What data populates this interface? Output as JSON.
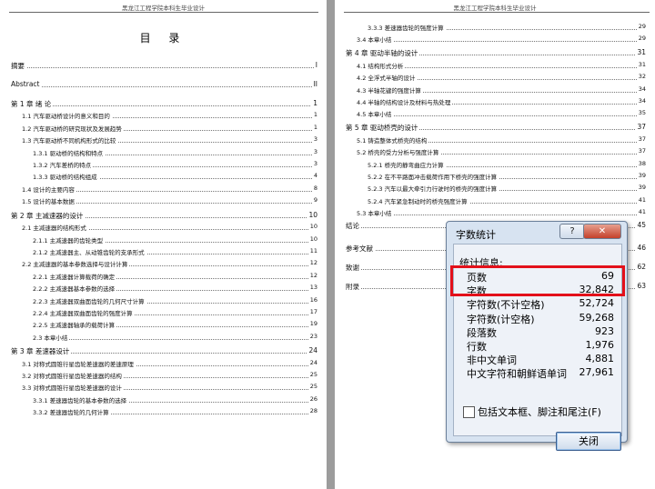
{
  "header_text": "黑龙江工程学院本科生毕业设计",
  "toc_title": "目  录",
  "page1_entries": [
    {
      "text": "摘要",
      "page": "I",
      "lvl": 1
    },
    {
      "text": "Abstract",
      "page": "II",
      "lvl": 1
    },
    {
      "text": "第 1 章  绪 论",
      "page": "1",
      "lvl": 1
    },
    {
      "text": "1.1 汽车驱动桥设计的意义和目的",
      "page": "1",
      "lvl": 2
    },
    {
      "text": "1.2 汽车驱动桥的研究现状及发展趋势",
      "page": "1",
      "lvl": 2
    },
    {
      "text": "1.3 汽车驱动桥不同机构形式的比较",
      "page": "3",
      "lvl": 2
    },
    {
      "text": "1.3.1 驱动桥的结构和特点",
      "page": "3",
      "lvl": 3
    },
    {
      "text": "1.3.2 汽车差桥的特点",
      "page": "3",
      "lvl": 3
    },
    {
      "text": "1.3.3 驱动桥的结构组成",
      "page": "4",
      "lvl": 3
    },
    {
      "text": "1.4 设计的主要内容",
      "page": "8",
      "lvl": 2
    },
    {
      "text": "1.5 设计的基本数据",
      "page": "9",
      "lvl": 2
    },
    {
      "text": "第 2 章  主减速器的设计",
      "page": "10",
      "lvl": 1
    },
    {
      "text": "2.1 主减速器的结构形式",
      "page": "10",
      "lvl": 2
    },
    {
      "text": "2.1.1 主减速器的齿轮类型",
      "page": "10",
      "lvl": 3
    },
    {
      "text": "2.1.2 主减速器主、从动锥齿轮的支承形式",
      "page": "11",
      "lvl": 3
    },
    {
      "text": "2.2 主减速器的基本参数选择与设计计算",
      "page": "12",
      "lvl": 2
    },
    {
      "text": "2.2.1 主减速器计算载荷的确定",
      "page": "12",
      "lvl": 3
    },
    {
      "text": "2.2.2 主减速器基本参数的选择",
      "page": "13",
      "lvl": 3
    },
    {
      "text": "2.2.3 主减速器双曲面齿轮的几何尺寸计算",
      "page": "16",
      "lvl": 3
    },
    {
      "text": "2.2.4 主减速器双曲面齿轮的强度计算",
      "page": "17",
      "lvl": 3
    },
    {
      "text": "2.2.5 主减速器轴承的载荷计算",
      "page": "19",
      "lvl": 3
    },
    {
      "text": "2.3 本章小结",
      "page": "23",
      "lvl": 3
    },
    {
      "text": "第 3 章  差速器设计",
      "page": "24",
      "lvl": 1
    },
    {
      "text": "3.1 对称式圆锥行星齿轮差速器的差速原理",
      "page": "24",
      "lvl": 2
    },
    {
      "text": "3.2 对称式圆锥行星齿轮差速器的结构",
      "page": "25",
      "lvl": 2
    },
    {
      "text": "3.3 对称式圆锥行星齿轮差速器的设计",
      "page": "25",
      "lvl": 2
    },
    {
      "text": "3.3.1 差速器齿轮的基本参数的选择",
      "page": "26",
      "lvl": 3
    },
    {
      "text": "3.3.2 差速器齿轮的几何计算",
      "page": "28",
      "lvl": 3
    }
  ],
  "page2_entries": [
    {
      "text": "3.3.3 差速器齿轮的强度计算",
      "page": "29",
      "lvl": 3
    },
    {
      "text": "3.4 本章小结",
      "page": "29",
      "lvl": 2
    },
    {
      "text": "第 4 章  驱动半轴的设计",
      "page": "31",
      "lvl": 1
    },
    {
      "text": "4.1 结构形式分析",
      "page": "31",
      "lvl": 2
    },
    {
      "text": "4.2 全浮式半轴的设计",
      "page": "32",
      "lvl": 2
    },
    {
      "text": "4.3 半轴花键的强度计算",
      "page": "34",
      "lvl": 2
    },
    {
      "text": "4.4 半轴的结构设计及材料与热处理",
      "page": "34",
      "lvl": 2
    },
    {
      "text": "4.5 本章小结",
      "page": "35",
      "lvl": 2
    },
    {
      "text": "第 5 章  驱动桥壳的设计",
      "page": "37",
      "lvl": 1
    },
    {
      "text": "5.1 铸造整体式桥壳的结构",
      "page": "37",
      "lvl": 2
    },
    {
      "text": "5.2 桥壳的受力分析与强度计算",
      "page": "37",
      "lvl": 2
    },
    {
      "text": "5.2.1 桥壳的静弯曲应力计算",
      "page": "38",
      "lvl": 3
    },
    {
      "text": "5.2.2 在不平路面冲击载荷作用下桥壳的强度计算",
      "page": "39",
      "lvl": 3
    },
    {
      "text": "5.2.3 汽车以最大牵引力行驶时的桥壳的强度计算",
      "page": "39",
      "lvl": 3
    },
    {
      "text": "5.2.4 汽车紧急制动时的桥壳强度计算",
      "page": "41",
      "lvl": 3
    },
    {
      "text": "5.3 本章小结",
      "page": "41",
      "lvl": 2
    },
    {
      "text": "结论",
      "page": "45",
      "lvl": 1
    },
    {
      "text": "参考文献",
      "page": "46",
      "lvl": 1
    },
    {
      "text": "致谢",
      "page": "62",
      "lvl": 1
    },
    {
      "text": "附录",
      "page": "63",
      "lvl": 1
    }
  ],
  "dialog": {
    "title": "字数统计",
    "help_label": "?",
    "close_label": "✕",
    "stats_header": "统计信息:",
    "stats": [
      {
        "label": "页数",
        "value": "69"
      },
      {
        "label": "字数",
        "value": "32,842"
      },
      {
        "label": "字符数(不计空格)",
        "value": "52,724"
      },
      {
        "label": "字符数(计空格)",
        "value": "59,268"
      },
      {
        "label": "段落数",
        "value": "923"
      },
      {
        "label": "行数",
        "value": "1,976"
      },
      {
        "label": "非中文单词",
        "value": "4,881"
      },
      {
        "label": "中文字符和朝鲜语单词",
        "value": "27,961"
      }
    ],
    "checkbox_label": "包括文本框、脚注和尾注(F)",
    "checkbox_checked": false,
    "close_button_label": "关闭"
  }
}
